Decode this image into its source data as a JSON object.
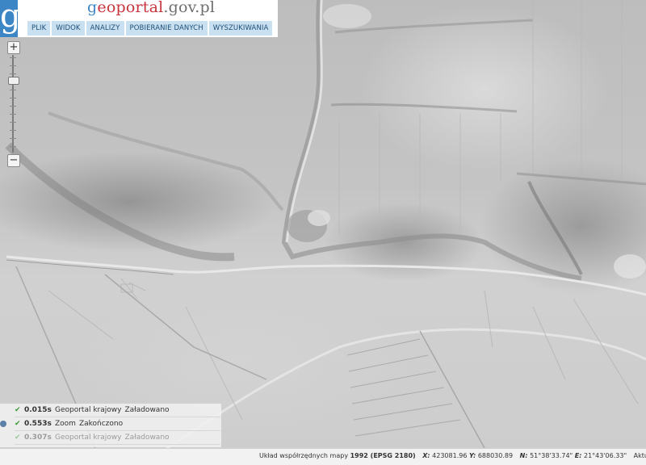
{
  "header": {
    "logo_letter": "g",
    "site_title": {
      "g": "g",
      "portal": "eoportal",
      "domain": ".gov.pl"
    },
    "menu": [
      {
        "label": "PLIK"
      },
      {
        "label": "WIDOK"
      },
      {
        "label": "ANALIZY"
      },
      {
        "label": "POBIERANIE DANYCH"
      },
      {
        "label": "WYSZUKIWANIA"
      }
    ]
  },
  "zoom": {
    "plus": "+",
    "minus": "−",
    "level_fraction": 0.26
  },
  "log": [
    {
      "check": "✔",
      "time": "0.015s",
      "name": "Geoportal krajowy",
      "status": "Załadowano"
    },
    {
      "check": "✔",
      "time": "0.553s",
      "name": "Zoom",
      "status": "Zakończono"
    },
    {
      "check": "✔",
      "time": "0.307s",
      "name": "Geoportal krajowy",
      "status": "Załadowano"
    }
  ],
  "coords": {
    "system_label": "Układ współrzędnych mapy",
    "system_value": "1992 (EPSG 2180)",
    "x_label": "X:",
    "x_value": "423081.96",
    "y_label": "Y:",
    "y_value": "688030.89",
    "n_label": "N:",
    "n_value": "51°38'33.74\"",
    "e_label": "E:",
    "e_value": "21°43'06.33\"",
    "trailing": "Aktu"
  },
  "colors": {
    "brand_blue": "#3d86c6",
    "brand_red": "#c8343c",
    "menu_bg": "#c8e0f0",
    "menu_text": "#1f4e78",
    "check_green": "#3b9a3b"
  }
}
